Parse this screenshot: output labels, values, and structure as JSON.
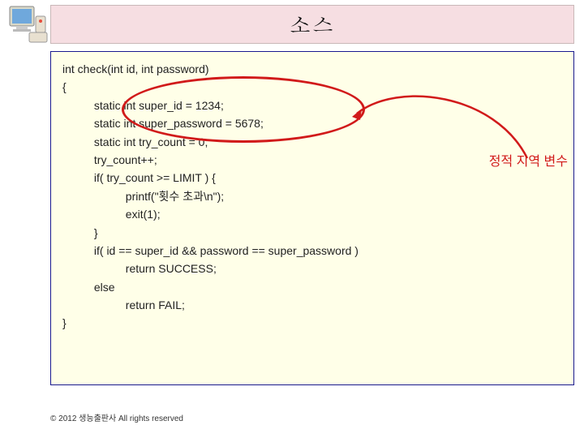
{
  "title": "소스",
  "code": {
    "l1": "int check(int id, int password)",
    "l2": "{",
    "l3": "          static int super_id = 1234;",
    "l4": "          static int super_password = 5678;",
    "l5": "          static int try_count = 0;",
    "l6": "",
    "l7": "          try_count++;",
    "l8": "          if( try_count >= LIMIT ) {",
    "l9": "                    printf(\"횟수 초과\\n\");",
    "l10": "                    exit(1);",
    "l11": "          }",
    "l12": "          if( id == super_id && password == super_password )",
    "l13": "                    return SUCCESS;",
    "l14": "          else",
    "l15": "                    return FAIL;",
    "l16": "}"
  },
  "annotation": "정적 지역 변수",
  "footer": "© 2012 생능출판사 All rights reserved"
}
